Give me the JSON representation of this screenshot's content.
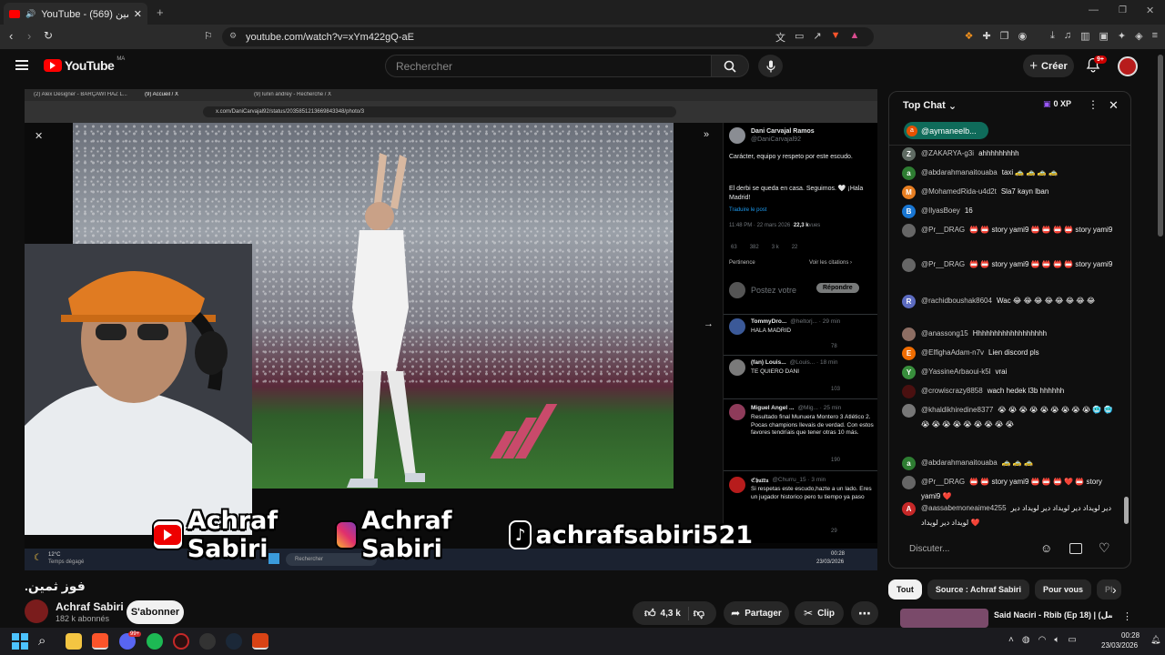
{
  "browser": {
    "tab_title": "YouTube - فوز ثمين (569)",
    "url": "youtube.com/watch?v=xYm422gQ-aE"
  },
  "youtube": {
    "logo_text": "YouTube",
    "logo_region": "MA",
    "search_placeholder": "Rechercher",
    "create_label": "Créer",
    "notif_count": "9+"
  },
  "video": {
    "inner_tabs": [
      "(2) Alex Designer - BARÇAWI HAZ L...",
      "(9) Accueil / X",
      "(9) lunin andrey - Recherche / X"
    ],
    "inner_url": "x.com/DaniCarvajal92/status/2035851213669843348/photo/3",
    "tweet": {
      "name": "Dani Carvajal Ramos",
      "handle": "@DaniCarvajal92",
      "text1": "Carácter, equipo y respeto por este escudo.",
      "text2": "El derbi se queda en casa. Seguimos. 🤍 ¡Hala Madrid!",
      "translate": "Traduire le post",
      "time": "11:48 PM · 22 mars 2026 · ",
      "views": "22,3 k",
      "views_label": " vues",
      "stats": [
        "63",
        "382",
        "3 k",
        "22"
      ],
      "pertinence": "Pertinence",
      "view_quotes": "Voir les citations ›",
      "reply_placeholder": "Postez votre",
      "reply_btn": "Répondre"
    },
    "replies": [
      {
        "name": "TommyDro...",
        "handle": "@heltorj... · 29 min",
        "text": "HALA MADRID",
        "views": "78"
      },
      {
        "name": "(fan) Louis...",
        "handle": "@Louis... · 18 min",
        "text": "TE QUIERO DANI",
        "views": "103"
      },
      {
        "name": "Miguel Angel ...",
        "handle": "@Mig... · 25 min",
        "text": "Resultado final Munuera Montero 3 Atlético 2. Pocas champions llevais de verdad. Con estos favores tendríais que tener otras 10 más.",
        "views": "190"
      },
      {
        "name": "ℭ𝔥𝔲𝔯𝔯𝔲",
        "handle": "@Churru_15 · 3 min",
        "text": "Si respetas este escudo,hazte a un lado. Eres un jugador historico pero tu tiempo ya paso",
        "views": "29"
      }
    ],
    "weather_temp": "12°C",
    "weather_label": "Temps dégagé",
    "inner_search": "Rechercher",
    "inner_clock_time": "00:28",
    "inner_clock_date": "23/03/2026",
    "inner_lang": "FRA\nFR",
    "banner_yt": "Achraf Sabiri",
    "banner_ig": "Achraf Sabiri",
    "banner_tt": "achrafsabiri521"
  },
  "below": {
    "title": ".فوز ثمين",
    "channel": "Achraf Sabiri",
    "subs": "182 k abonnés",
    "subscribe": "S'abonner",
    "likes": "4,3 k",
    "share": "Partager",
    "clip": "Clip"
  },
  "chat": {
    "title": "Top Chat",
    "xp": "0 XP",
    "pinned": "@aymaneelb...",
    "input_placeholder": "Discuter...",
    "messages": [
      {
        "initial": "Z",
        "color": "#5f6b63",
        "author": "@ZAKARYA-g3i",
        "text": "ahhhhhhhhh"
      },
      {
        "initial": "a",
        "color": "#2e7d32",
        "author": "@abdarahmanaitouaba",
        "text": "taxi 🚕 🚕 🚕 🚕"
      },
      {
        "initial": "M",
        "color": "#e67e22",
        "author": "@MohamedRida-u4d2t",
        "text": "Sla7 kayn lban"
      },
      {
        "initial": "B",
        "color": "#1976d2",
        "author": "@IlyasBoey",
        "text": "16"
      },
      {
        "initial": "",
        "color": "#666",
        "author": "@Pr__DRAG",
        "text": "📛 📛 story yami9 📛 📛 📛 📛 story yami9"
      },
      {
        "initial": "",
        "color": "#666",
        "author": "@Pr__DRAG",
        "text": "📛 📛 story yami9 📛 📛 📛 📛 story yami9"
      },
      {
        "initial": "R",
        "color": "#5c6bc0",
        "author": "@rachidboushak8604",
        "text": "Wac 😂 😂 😂 😂 😂 😂 😂 😂"
      },
      {
        "initial": "",
        "color": "#8d6e63",
        "author": "@anassong15",
        "text": "Hhhhhhhhhhhhhhhhhh"
      },
      {
        "initial": "E",
        "color": "#ef6c00",
        "author": "@ElfighaAdam-n7v",
        "text": "Lien discord pls"
      },
      {
        "initial": "Y",
        "color": "#388e3c",
        "author": "@YassineArbaoui-k5l",
        "text": "vrai"
      },
      {
        "initial": "",
        "color": "#4a1010",
        "author": "@crowiscrazy8858",
        "text": "wach hedek l3b hhhhhh"
      },
      {
        "initial": "",
        "color": "#777",
        "author": "@khaldikhiredine8377",
        "text": "😭 😭 😭 😭 😭 😭 😭 😭 😭 🥶 🥶 😭 😭 😭 😭 😭 😭 😭 😭 😭"
      },
      {
        "initial": "a",
        "color": "#2e7d32",
        "author": "@abdarahmanaitouaba",
        "text": "🚕 🚕 🚕"
      },
      {
        "initial": "",
        "color": "#666",
        "author": "@Pr__DRAG",
        "text": "📛 📛 story yami9 📛 📛 📛 ❤️ 📛 story yami9 ❤️"
      },
      {
        "initial": "A",
        "color": "#c62828",
        "author": "@aassabemoneaime4255",
        "text": "دير لويداد دير لويداد دير لويداد دير لويداد دير لويداد ❤️"
      }
    ]
  },
  "chips": [
    "Tout",
    "Source : Achraf Sabiri",
    "Pour vous",
    "Pl"
  ],
  "suggestion": {
    "title": "Said Naciri - Rbib (Ep 18) | (مسلسل"
  },
  "taskbar": {
    "time": "00:28",
    "date": "23/03/2026",
    "steam_badge": "99+"
  },
  "colors": {
    "youtube_red": "#ff0000",
    "chat_bg": "#0f0f0f",
    "taskbar": "#1b1b1f"
  }
}
